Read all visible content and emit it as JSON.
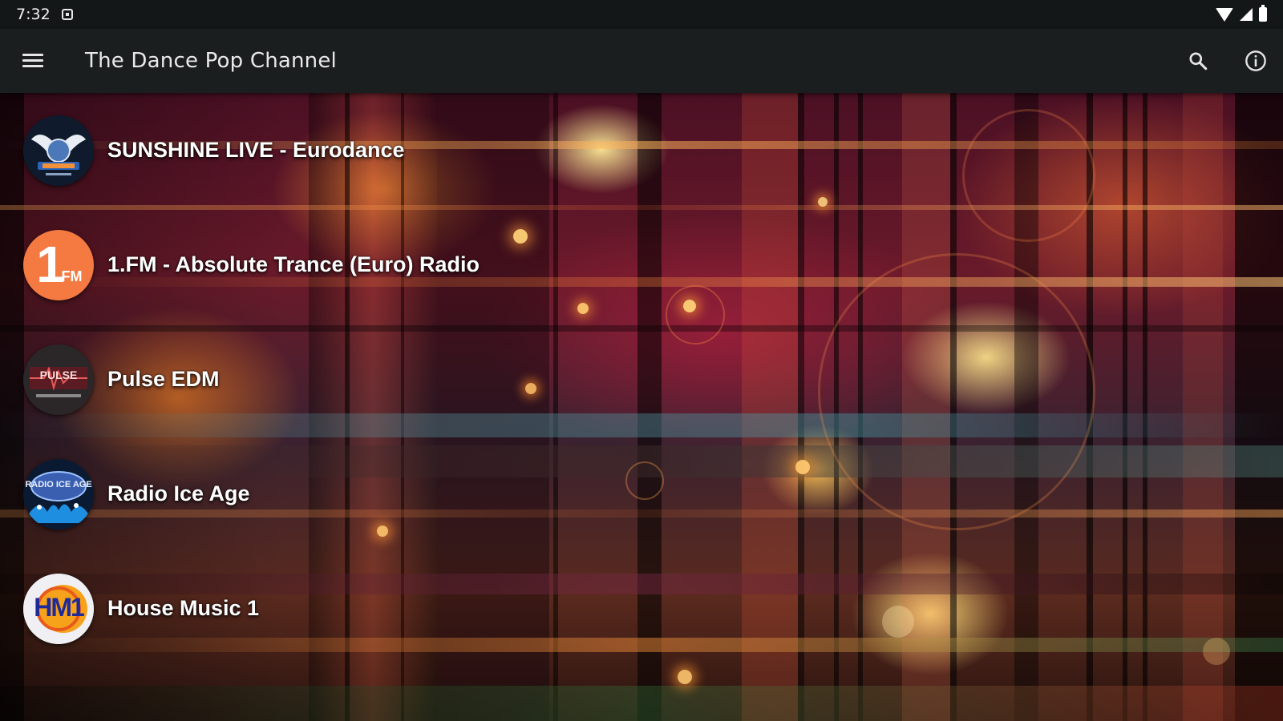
{
  "status_bar": {
    "time": "7:32",
    "icons": [
      "notification-icon",
      "wifi-icon",
      "signal-icon",
      "battery-icon"
    ]
  },
  "app_bar": {
    "title": "The Dance Pop Channel",
    "icons": [
      "menu-icon",
      "search-icon",
      "info-icon"
    ]
  },
  "stations": [
    {
      "name": "SUNSHINE LIVE - Eurodance",
      "logo": "sunshine-live-logo"
    },
    {
      "name": "1.FM - Absolute Trance (Euro) Radio",
      "logo": "1fm-logo",
      "logo_text": ".FM",
      "logo_number": "1"
    },
    {
      "name": "Pulse EDM",
      "logo": "pulse-edm-logo",
      "logo_text": "PULSE"
    },
    {
      "name": "Radio Ice Age",
      "logo": "radio-ice-age-logo",
      "logo_text": "RADIO ICE AGE"
    },
    {
      "name": "House Music 1",
      "logo": "house-music-1-logo",
      "logo_text": "HM1"
    }
  ],
  "colors": {
    "status_bar_bg": "#141718",
    "app_bar_bg": "#1a1e1f",
    "text_primary": "#ffffff",
    "accent_orange": "#ff8a3d"
  }
}
